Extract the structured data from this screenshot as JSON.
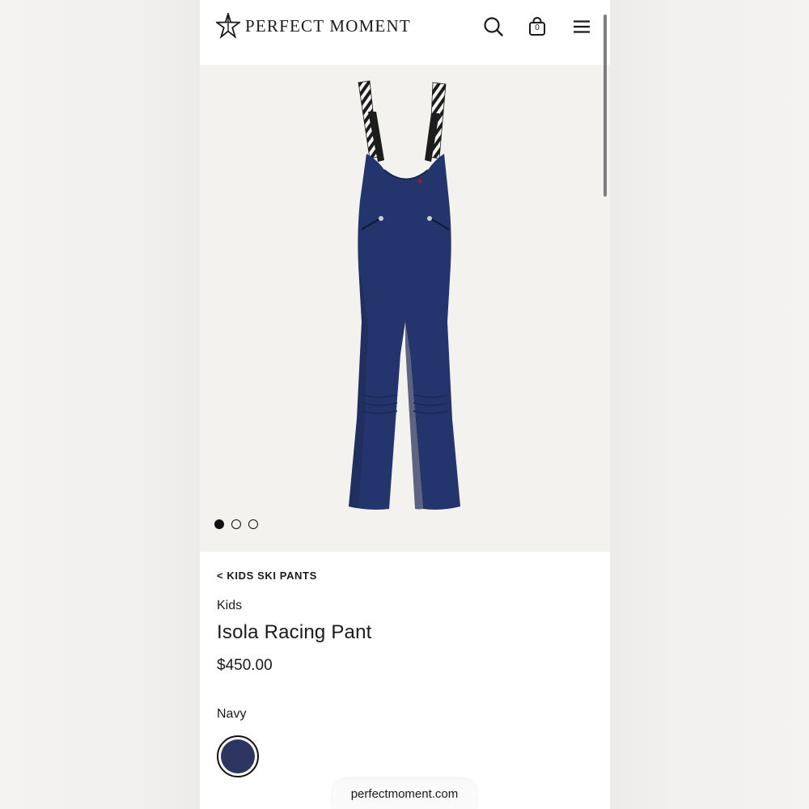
{
  "header": {
    "brand": "PERFECT MOMENT",
    "search_icon": "search-icon",
    "cart_icon": "shopping-bag-icon",
    "cart_count": "0",
    "menu_icon": "hamburger-menu-icon"
  },
  "gallery": {
    "image_count": 3,
    "active_index": 0,
    "background": "#f4f2ee"
  },
  "product": {
    "breadcrumb": "< KIDS SKI PANTS",
    "category": "Kids",
    "name": "Isola Racing Pant",
    "price": "$450.00",
    "color_name": "Navy",
    "swatch_color": "#2d3561"
  },
  "browser": {
    "url": "perfectmoment.com"
  }
}
